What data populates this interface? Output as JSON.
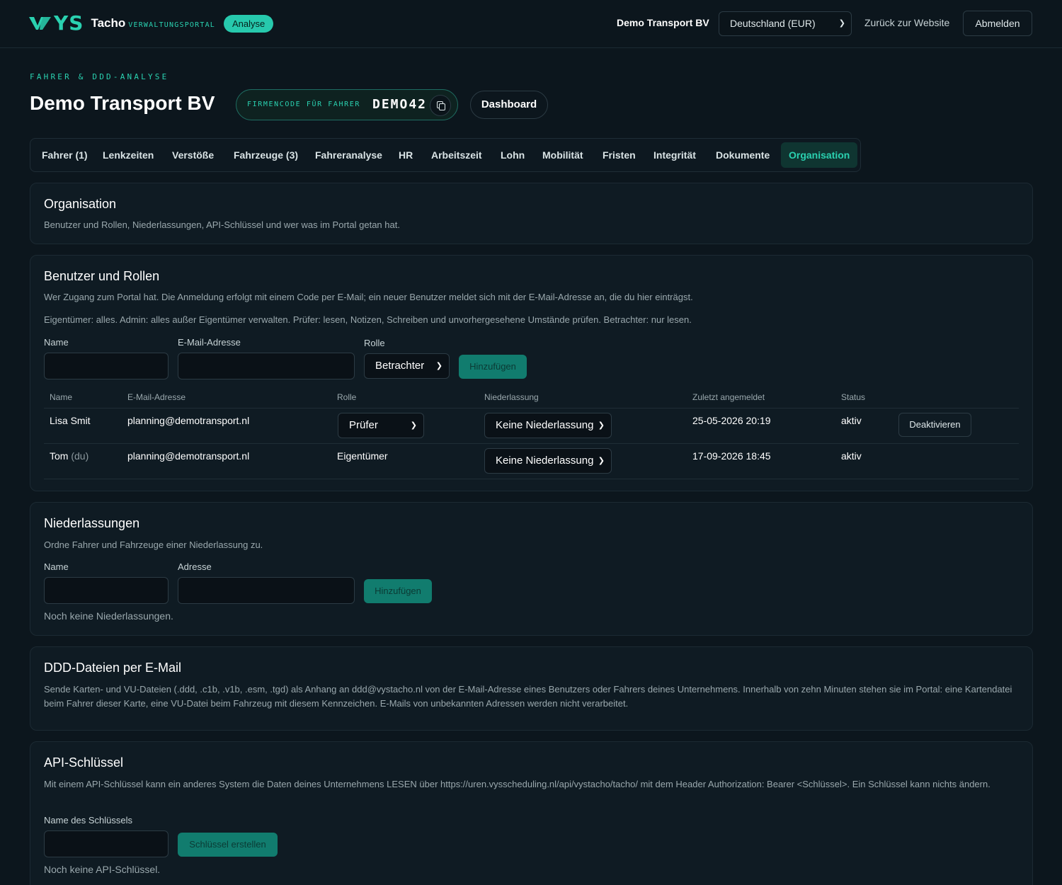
{
  "header": {
    "logo_mark": "YS",
    "logo_title": "Tacho",
    "logo_subtitle": "VERWALTUNGSPORTAL",
    "badge": "Analyse",
    "company": "Demo Transport BV",
    "country_select": "Deutschland (EUR)",
    "back_link": "Zurück zur Website",
    "logout": "Abmelden"
  },
  "page": {
    "eyebrow": "FAHRER & DDD-ANALYSE",
    "title": "Demo Transport BV",
    "company_code_label": "FIRMENCODE FÜR FAHRER",
    "company_code": "DEMO42",
    "dashboard_button": "Dashboard"
  },
  "tabs": [
    {
      "label": "Fahrer (1)"
    },
    {
      "label": "Lenkzeiten"
    },
    {
      "label": "Verstöße"
    },
    {
      "label": "Fahrzeuge (3)"
    },
    {
      "label": "Fahreranalyse"
    },
    {
      "label": "HR"
    },
    {
      "label": "Arbeitszeit"
    },
    {
      "label": "Lohn"
    },
    {
      "label": "Mobilität"
    },
    {
      "label": "Fristen"
    },
    {
      "label": "Integrität"
    },
    {
      "label": "Dokumente"
    },
    {
      "label": "Organisation",
      "active": true
    }
  ],
  "organisation": {
    "title": "Organisation",
    "description": "Benutzer und Rollen, Niederlassungen, API-Schlüssel und wer was im Portal getan hat."
  },
  "users": {
    "title": "Benutzer und Rollen",
    "description1": "Wer Zugang zum Portal hat. Die Anmeldung erfolgt mit einem Code per E-Mail; ein neuer Benutzer meldet sich mit der E-Mail-Adresse an, die du hier einträgst.",
    "description2": "Eigentümer: alles. Admin: alles außer Eigentümer verwalten. Prüfer: lesen, Notizen, Schreiben und unvorhergesehene Umstände prüfen. Betrachter: nur lesen.",
    "form": {
      "name_label": "Name",
      "email_label": "E-Mail-Adresse",
      "role_label": "Rolle",
      "role_value": "Betrachter",
      "add_button": "Hinzufügen"
    },
    "columns": [
      "Name",
      "E-Mail-Adresse",
      "Rolle",
      "Niederlassung",
      "Zuletzt angemeldet",
      "Status"
    ],
    "rows": [
      {
        "name": "Lisa Smit",
        "suffix": "",
        "email": "planning@demotransport.nl",
        "role": "Prüfer",
        "branch": "Keine Niederlassung",
        "last_login": "25-05-2026 20:19",
        "status": "aktiv",
        "action": "Deaktivieren"
      },
      {
        "name": "Tom",
        "suffix": "(du)",
        "email": "planning@demotransport.nl",
        "role": "Eigentümer",
        "branch": "Keine Niederlassung",
        "last_login": "17-09-2026 18:45",
        "status": "aktiv"
      }
    ]
  },
  "branches": {
    "title": "Niederlassungen",
    "description": "Ordne Fahrer und Fahrzeuge einer Niederlassung zu.",
    "name_label": "Name",
    "address_label": "Adresse",
    "add_button": "Hinzufügen",
    "empty": "Noch keine Niederlassungen."
  },
  "ddd_email": {
    "title": "DDD-Dateien per E-Mail",
    "description": "Sende Karten- und VU-Dateien (.ddd, .c1b, .v1b, .esm, .tgd) als Anhang an ddd@vystacho.nl von der E-Mail-Adresse eines Benutzers oder Fahrers deines Unternehmens. Innerhalb von zehn Minuten stehen sie im Portal: eine Kartendatei beim Fahrer dieser Karte, eine VU-Datei beim Fahrzeug mit diesem Kennzeichen. E-Mails von unbekannten Adressen werden nicht verarbeitet."
  },
  "api_keys": {
    "title": "API-Schlüssel",
    "description": "Mit einem API-Schlüssel kann ein anderes System die Daten deines Unternehmens LESEN über https://uren.vysscheduling.nl/api/vystacho/tacho/ mit dem Header Authorization: Bearer <Schlüssel>. Ein Schlüssel kann nichts ändern.",
    "name_label": "Name des Schlüssels",
    "create_button": "Schlüssel erstellen",
    "empty": "Noch keine API-Schlüssel."
  },
  "colors": {
    "background": "#0c161d",
    "card": "#0f1b23",
    "accent": "#2ad1b0",
    "button": "#117c6e"
  },
  "icons": {
    "copy": "copy-icon",
    "chevron": "chevron-down-icon",
    "logo": "vys-logo-icon"
  }
}
